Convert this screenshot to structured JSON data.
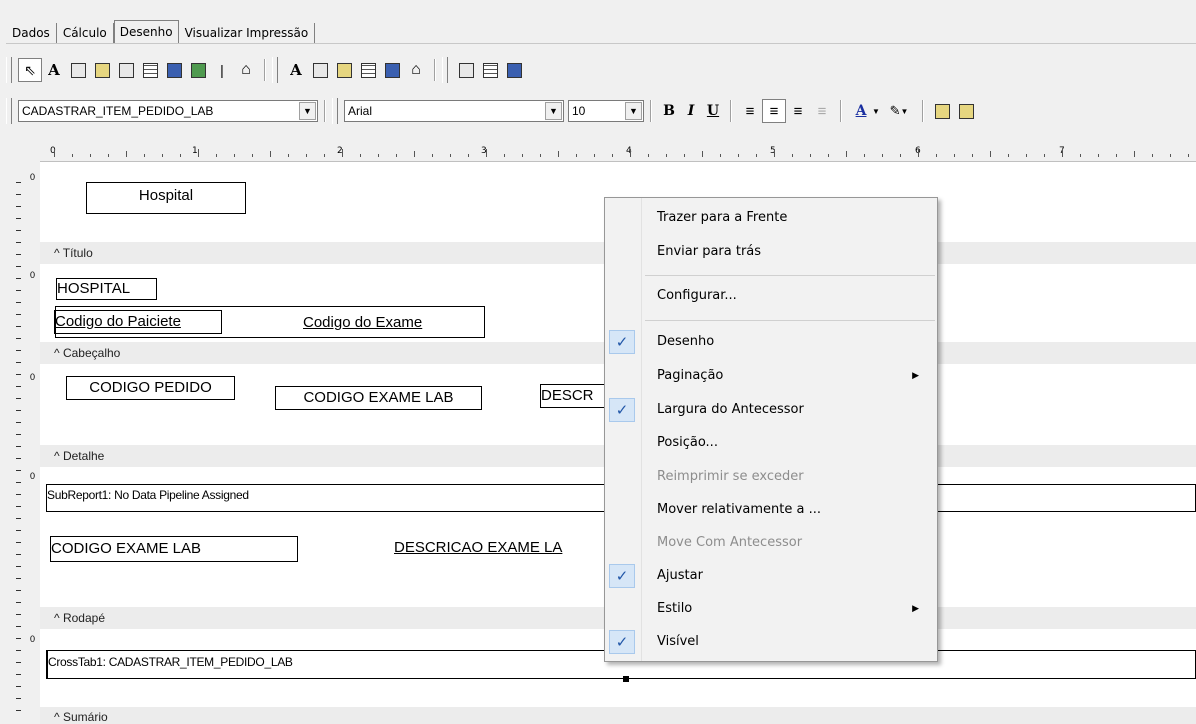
{
  "tabs": [
    "Dados",
    "Cálculo",
    "Desenho",
    "Visualizar Impressão"
  ],
  "active_tab": "Desenho",
  "format_bar": {
    "datasource": "CADASTRAR_ITEM_PEDIDO_LAB",
    "font_name": "Arial",
    "font_size": "10",
    "bold": "B",
    "italic": "I",
    "underline": "U",
    "font_color_label": "A"
  },
  "ruler": {
    "marks": [
      "0",
      "1",
      "2",
      "3",
      "4",
      "5",
      "6",
      "7"
    ]
  },
  "bands": {
    "titulo": "Título",
    "cabecalho": "Cabeçalho",
    "detalhe": "Detalhe",
    "rodape": "Rodapé",
    "sumario": "Sumário"
  },
  "report": {
    "title_box": "Hospital",
    "hospital": "HOSPITAL",
    "codigo_paciente": "Codigo do Paiciete",
    "codigo_exame": "Codigo do Exame",
    "codigo_pedido": "CODIGO PEDIDO",
    "codigo_exame_lab": "CODIGO EXAME LAB",
    "descr_partial": "DESCR",
    "subreport": "SubReport1: No Data Pipeline Assigned",
    "codigo_exame_lab_2": "CODIGO EXAME LAB",
    "descricao_exame": "DESCRICAO EXAME LA",
    "crosstab": "CrossTab1: CADASTRAR_ITEM_PEDIDO_LAB",
    "vruler_zero": "0"
  },
  "context_menu": {
    "items": [
      {
        "label": "Trazer para a Frente",
        "checked": false,
        "disabled": false
      },
      {
        "label": "Enviar para trás",
        "checked": false,
        "disabled": false
      },
      {
        "label": "Configurar...",
        "checked": false,
        "disabled": false
      },
      {
        "label": "Desenho",
        "checked": true,
        "disabled": false
      },
      {
        "label": "Paginação",
        "checked": false,
        "disabled": false,
        "submenu": true
      },
      {
        "label": "Largura do Antecessor",
        "checked": true,
        "disabled": false
      },
      {
        "label": "Posição...",
        "checked": false,
        "disabled": false
      },
      {
        "label": "Reimprimir se exceder",
        "checked": false,
        "disabled": true
      },
      {
        "label": "Mover relativamente a ...",
        "checked": false,
        "disabled": false
      },
      {
        "label": "Move Com Antecessor",
        "checked": false,
        "disabled": true
      },
      {
        "label": "Ajustar",
        "checked": true,
        "disabled": false
      },
      {
        "label": "Estilo",
        "checked": false,
        "disabled": false,
        "submenu": true
      },
      {
        "label": "Visível",
        "checked": true,
        "disabled": false
      }
    ],
    "check_glyph": "✓",
    "submenu_glyph": "▶"
  },
  "colors": {
    "menu_check_bg": "#d6e6f7",
    "band_bar": "#ececec"
  }
}
